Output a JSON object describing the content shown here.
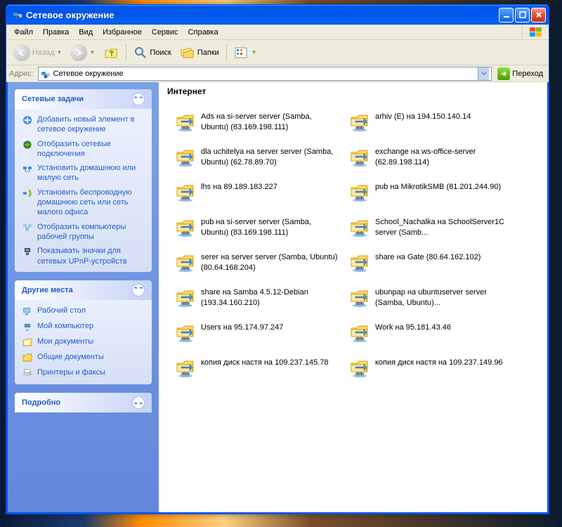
{
  "window": {
    "title": "Сетевое окружение"
  },
  "menubar": [
    "Файл",
    "Правка",
    "Вид",
    "Избранное",
    "Сервис",
    "Справка"
  ],
  "toolbar": {
    "back": "Назад",
    "search": "Поиск",
    "folders": "Папки"
  },
  "addressbar": {
    "label": "Адрес:",
    "value": "Сетевое окружение",
    "go": "Переход"
  },
  "sidebar": {
    "tasks": {
      "title": "Сетевые задачи",
      "items": [
        "Добавить новый элемент в сетевое окружение",
        "Отобразить сетевые подключения",
        "Установить домашнюю или малую сеть",
        "Установить беспроводную домашнюю сеть или сеть малого офиса",
        "Отобразить компьютеры рабочей группы",
        "Показывать значки для сетевых UPnP-устройств"
      ]
    },
    "other": {
      "title": "Другие места",
      "items": [
        "Рабочий стол",
        "Мой компьютер",
        "Мои документы",
        "Общие документы",
        "Принтеры и факсы"
      ]
    },
    "details": {
      "title": "Подробно"
    }
  },
  "content": {
    "section": "Интернет",
    "items": [
      "Ads на si-server server (Samba, Ubuntu) (83.169.198.111)",
      "arhiv (E) на 194.150.140.14",
      "dla uchitelya на server server (Samba, Ubuntu) (62.78.89.70)",
      "exchange на ws-office-server (62.89.198.114)",
      "lhs на 89.189.183.227",
      "pub на MikrotikSMB (81.201.244.90)",
      "pub на si-server server (Samba, Ubuntu) (83.169.198.111)",
      "School_Nachalka на SchoolServer1C server (Samb...",
      "serer на server server (Samba, Ubuntu) (80.64.168.204)",
      "share на Gate (80.64.162.102)",
      "share на Samba 4.5.12-Debian (193.34.160.210)",
      "ubunpap на ubuntuserver server (Samba, Ubuntu)...",
      "Users на 95.174.97.247",
      "Work на 95.181.43.46",
      "копия диск настя на 109.237.145.78",
      "копия диск настя на 109.237.149.96"
    ]
  }
}
